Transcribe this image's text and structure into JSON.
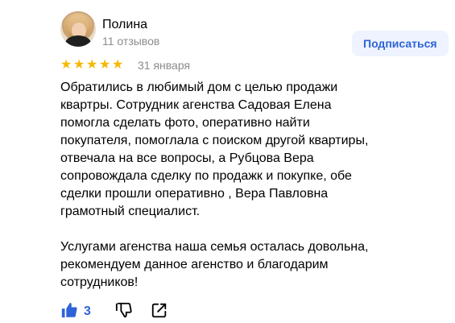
{
  "review": {
    "author": "Полина",
    "reviews_count": "11 отзывов",
    "subscribe_label": "Подписаться",
    "rating": 5,
    "rating_max": 5,
    "date": "31 января",
    "text": "Обратились в любимый дом с целью продажи\nквартры. Сотрудник агенства Садовая Елена\nпомогла сделать фото, оперативно найти\nпокупателя, помоглала с поиском другой квартиры,\nотвечала на все вопросы, а Рубцова Вера\nсопровождала сделку по продажк и покупке, обе\nсделки прошли оперативно , Вера Павловна\nграмотный специалист.\n\nУслугами агенства наша семья осталась довольна,\nрекомендуем данное агенство и благодарим\nсотрудников!",
    "likes": "3"
  },
  "icons": {
    "star": "star-icon",
    "like": "thumb-up-icon",
    "dislike": "thumb-down-icon",
    "share": "share-icon"
  },
  "colors": {
    "accent": "#2f63d8",
    "star": "#f6b800",
    "muted": "#8c8c8c",
    "button_bg": "#eef3ff"
  }
}
